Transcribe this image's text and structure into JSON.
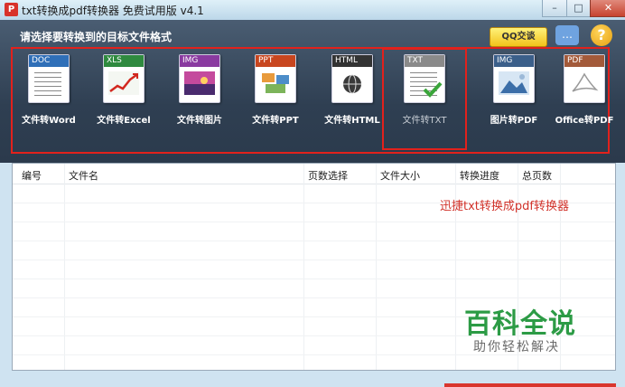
{
  "window": {
    "title": "txt转换成pdf转换器 免费试用版 v4.1",
    "app_icon": "pdf-app-icon",
    "controls": {
      "minimize": "–",
      "maximize": "□",
      "close": "✕"
    }
  },
  "toolbar": {
    "prompt": "请选择要转换到的目标文件格式",
    "qq_label": "QQ交谈",
    "help_label": "?",
    "formats": [
      {
        "tag": "DOC",
        "label": "文件转Word",
        "color": "#2f6fb8"
      },
      {
        "tag": "XLS",
        "label": "文件转Excel",
        "color": "#2f8a3f"
      },
      {
        "tag": "IMG",
        "label": "文件转图片",
        "color": "#8a3aa0"
      },
      {
        "tag": "PPT",
        "label": "文件转PPT",
        "color": "#c8461f"
      },
      {
        "tag": "HTML",
        "label": "文件转HTML",
        "color": "#333333"
      },
      {
        "tag": "TXT",
        "label": "文件转TXT",
        "color": "#8a8a8a"
      },
      {
        "tag": "IMG",
        "label": "图片转PDF",
        "color": "#3b5f8a"
      },
      {
        "tag": "PDF",
        "label": "Office转PDF",
        "color": "#a35a3a"
      }
    ],
    "selected_index": 5
  },
  "table": {
    "columns": [
      "编号",
      "文件名",
      "页数选择",
      "文件大小",
      "转换进度",
      "总页数"
    ],
    "rows": []
  },
  "watermark": {
    "red_text": "迅捷txt转换成pdf转换器",
    "logo": "百科全说",
    "sub": "助你轻松解决"
  }
}
